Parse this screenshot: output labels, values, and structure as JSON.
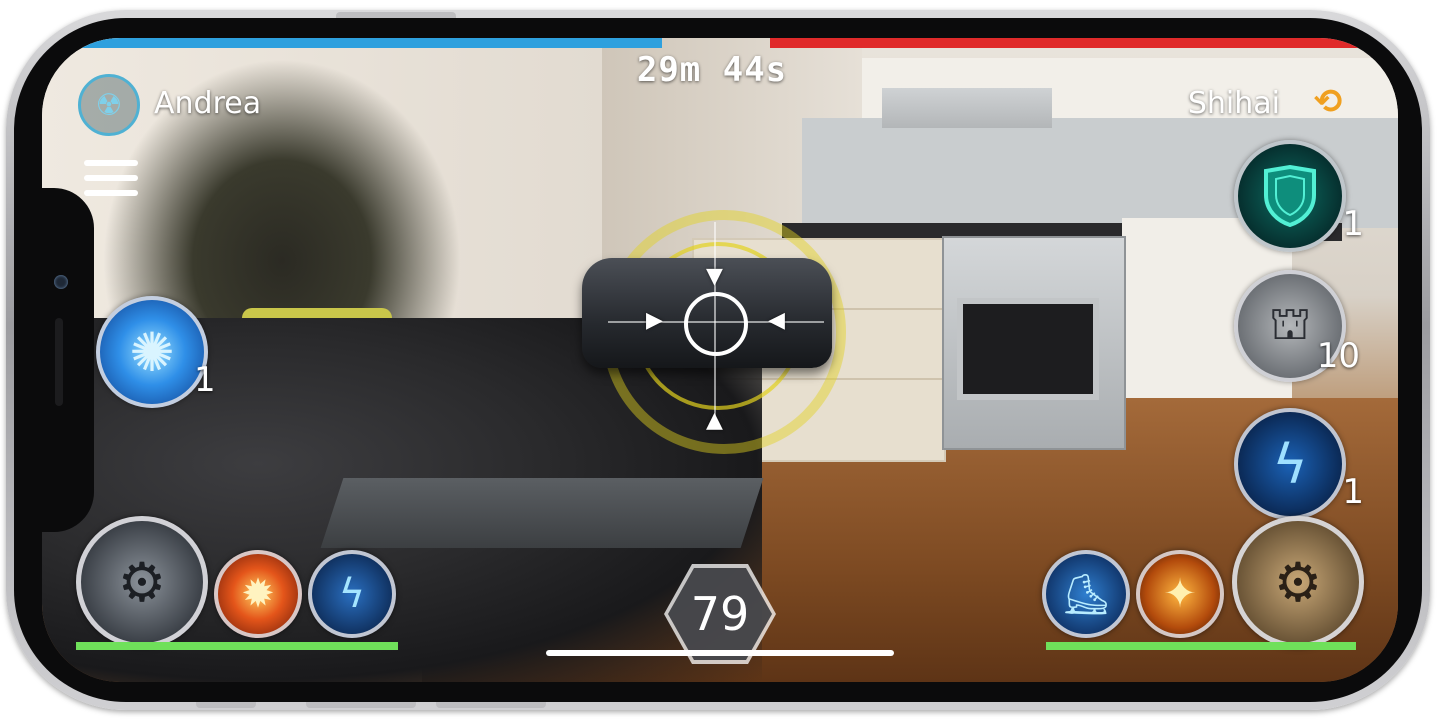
{
  "match": {
    "timer": "29m 44s",
    "team_colors": {
      "player": "#2ea0de",
      "opponent": "#e02a2a"
    },
    "team_bar_split": 0.47
  },
  "player": {
    "name": "Andrea",
    "faction_icon": "radiation-icon",
    "health_color": "#6fe05a"
  },
  "opponent": {
    "name": "Shihai",
    "faction_icon": "link-icon"
  },
  "left_hud": {
    "menu_icon": "hamburger-menu-icon",
    "energy_orb": {
      "icon": "blue-energy-orb-icon",
      "count": "1"
    },
    "hero": {
      "icon": "robot-hero-portrait-icon"
    },
    "abilities": [
      {
        "icon": "fire-blast-ability-icon"
      },
      {
        "icon": "lightning-ability-icon"
      }
    ]
  },
  "right_hud": {
    "cards": [
      {
        "icon": "shield-icon",
        "count": "1"
      },
      {
        "icon": "turret-icon",
        "count": "10"
      },
      {
        "icon": "lightning-icon",
        "count": "1"
      }
    ],
    "hero": {
      "icon": "mech-hero-portrait-icon"
    },
    "abilities": [
      {
        "icon": "boot-speed-icon"
      },
      {
        "icon": "missile-ability-icon"
      }
    ]
  },
  "energy": {
    "value": "79"
  },
  "target": {
    "reticle_color": "#e3d21e",
    "unit_icon": "gunship-icon"
  }
}
